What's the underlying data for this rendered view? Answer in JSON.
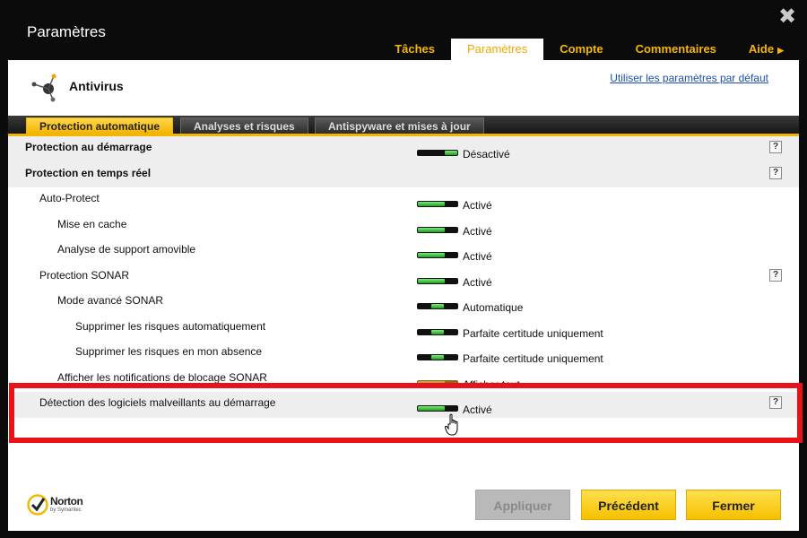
{
  "window": {
    "title": "Paramètres"
  },
  "top_tabs": [
    {
      "label": "Tâches"
    },
    {
      "label": "Paramètres"
    },
    {
      "label": "Compte"
    },
    {
      "label": "Commentaires"
    },
    {
      "label": "Aide"
    }
  ],
  "header": {
    "title": "Antivirus",
    "default_link": "Utiliser les paramètres par défaut"
  },
  "sub_tabs": [
    {
      "label": "Protection automatique"
    },
    {
      "label": "Analyses et risques"
    },
    {
      "label": "Antispyware et mises à jour"
    }
  ],
  "rows": [
    {
      "label": "Protection au démarrage",
      "state": "Désactivé",
      "help": "?"
    },
    {
      "label": "Protection en temps réel",
      "state": "",
      "help": "?"
    },
    {
      "label": "Auto-Protect",
      "state": "Activé"
    },
    {
      "label": "Mise en cache",
      "state": "Activé"
    },
    {
      "label": "Analyse de support amovible",
      "state": "Activé"
    },
    {
      "label": "Protection SONAR",
      "state": "Activé",
      "help": "?"
    },
    {
      "label": "Mode avancé SONAR",
      "state": "Automatique"
    },
    {
      "label": "Supprimer les risques automatiquement",
      "state": "Parfaite certitude uniquement"
    },
    {
      "label": "Supprimer les risques en mon absence",
      "state": "Parfaite certitude uniquement"
    },
    {
      "label": "Afficher les notifications de blocage SONAR",
      "state": "Afficher tout"
    },
    {
      "label": "Détection des logiciels malveillants au démarrage",
      "state": "Activé",
      "help": "?"
    }
  ],
  "brand": {
    "name": "Norton",
    "sub": "by Symantec"
  },
  "buttons": {
    "apply": "Appliquer",
    "previous": "Précédent",
    "close": "Fermer"
  },
  "colors": {
    "accent": "#f5b800",
    "highlight": "#e8121a",
    "toggle_on": "#22a822"
  }
}
